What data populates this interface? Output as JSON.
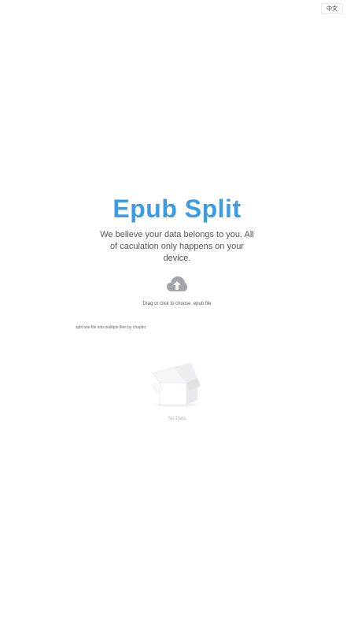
{
  "header": {
    "language_toggle_label": "中文"
  },
  "hero": {
    "title": "Epub Split",
    "tagline": "We believe your data belongs to you. All of caculation only happens on your device."
  },
  "upload": {
    "icon": "cloud-upload-icon",
    "instruction": "Drag or click to choose .epub file"
  },
  "description": {
    "text": "split one file into multiple files by chapter"
  },
  "empty_state": {
    "icon": "empty-box-icon",
    "label": "No Data"
  },
  "colors": {
    "title": "#3c9be6",
    "icon_gray": "#a3a6ad",
    "text_gray": "#555555",
    "muted": "#b5b5b5"
  }
}
